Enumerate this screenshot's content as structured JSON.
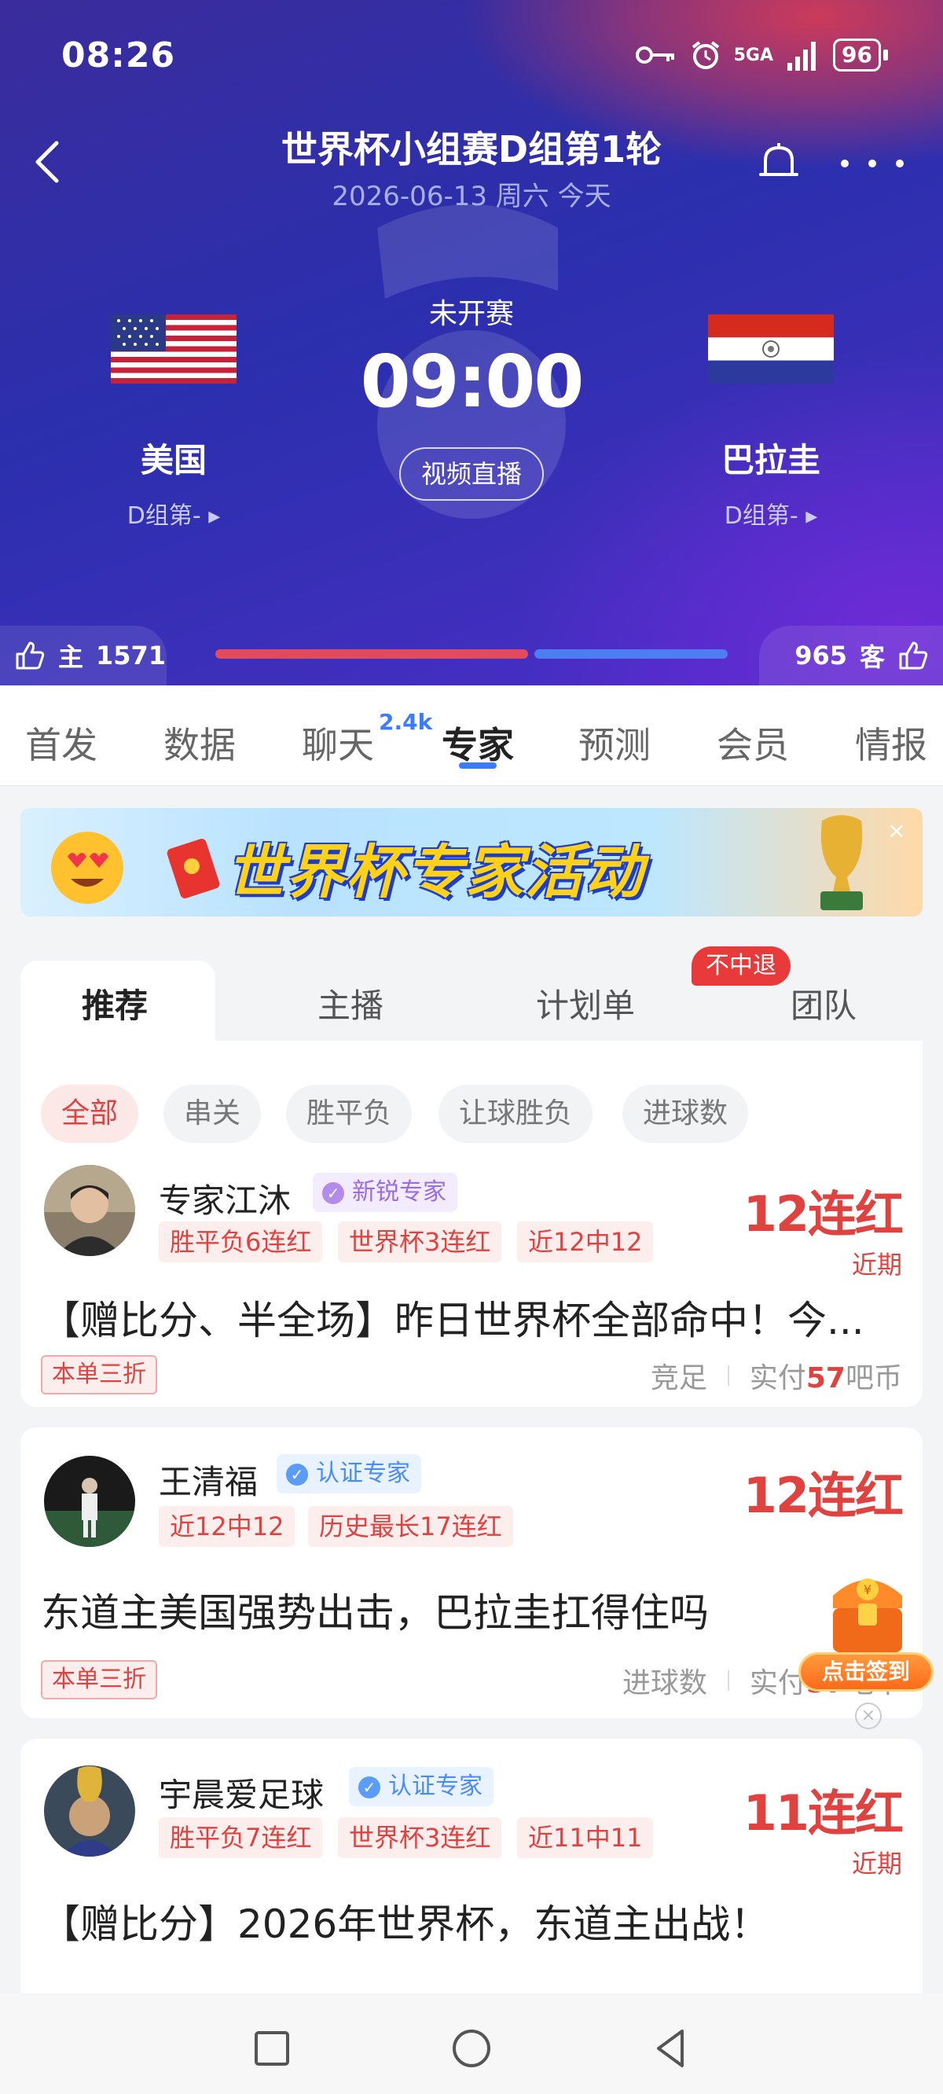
{
  "status_bar": {
    "time": "08:26",
    "network": "5GA",
    "battery": "96"
  },
  "header": {
    "title": "世界杯小组赛D组第1轮",
    "subtitle": "2026-06-13 周六 今天",
    "home_team": {
      "name": "美国",
      "group": "D组第-"
    },
    "away_team": {
      "name": "巴拉圭",
      "group": "D组第-"
    },
    "match_state": "未开赛",
    "kickoff": "09:00",
    "live_button": "视频直播",
    "home_votes_label": "主",
    "home_votes": "1571",
    "away_votes_label": "客",
    "away_votes": "965"
  },
  "tabs": {
    "items": [
      "首发",
      "数据",
      "聊天",
      "专家",
      "预测",
      "会员",
      "情报"
    ],
    "chat_badge": "2.4k",
    "active": "专家"
  },
  "banner": {
    "text": "世界杯专家活动",
    "close": "×"
  },
  "subtabs": {
    "items": [
      "推荐",
      "主播",
      "计划单",
      "团队"
    ],
    "hot_badge": "不中退",
    "active": "推荐"
  },
  "filters": {
    "items": [
      "全部",
      "串关",
      "胜平负",
      "让球胜负",
      "进球数"
    ],
    "active": "全部"
  },
  "cards": [
    {
      "name": "专家江沐",
      "cert": "新锐专家",
      "tags": [
        "胜平负6连红",
        "世界杯3连红",
        "近12中12"
      ],
      "streak": "12连红",
      "recent": "近期",
      "title": "【赠比分、半全场】昨日世界杯全部命中！今...",
      "discount": "本单三折",
      "category": "竞足",
      "price_prefix": "实付",
      "price": "57",
      "price_unit": "吧币"
    },
    {
      "name": "王清福",
      "cert": "认证专家",
      "tags": [
        "近12中12",
        "历史最长17连红"
      ],
      "streak": "12连红",
      "title": "东道主美国强势出击，巴拉圭扛得住吗",
      "discount": "本单三折",
      "category": "进球数",
      "price_prefix": "实付",
      "price": "57",
      "price_unit": "吧币"
    },
    {
      "name": "宇晨爱足球",
      "cert": "认证专家",
      "tags": [
        "胜平负7连红",
        "世界杯3连红",
        "近11中11"
      ],
      "streak": "11连红",
      "recent": "近期",
      "title": "【赠比分】2026年世界杯，东道主出战！"
    }
  ],
  "signin": {
    "label": "点击签到"
  },
  "colors": {
    "accent_red": "#e0423f",
    "accent_blue": "#3b7bff",
    "hero_bg": "#2b2fae"
  }
}
